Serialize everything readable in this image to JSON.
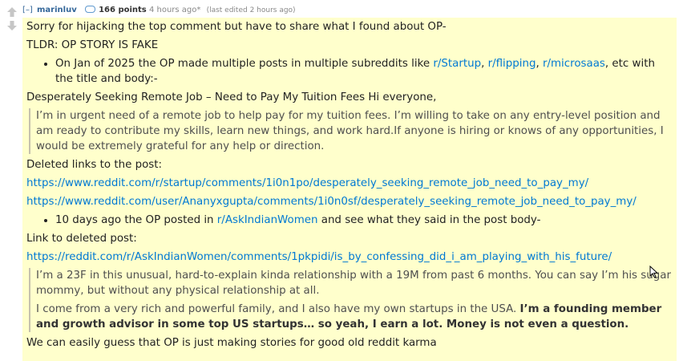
{
  "tagline": {
    "collapse": "[–]",
    "author": "marinluv",
    "score": "166 points",
    "time": "4 hours ago*",
    "edited": "(last edited 2 hours ago)"
  },
  "comment": {
    "p1": "Sorry for hijacking the top comment but have to share what I found about OP-",
    "p2": "TLDR: OP STORY IS FAKE",
    "li1_a": "On Jan of 2025 the OP made multiple posts in multiple subreddits like ",
    "li1_link1": "r/Startup",
    "li1_sep1": ", ",
    "li1_link2": "r/flipping",
    "li1_sep2": ", ",
    "li1_link3": "r/microsaas",
    "li1_b": ", etc with the title and body:-",
    "p3": "Desperately Seeking Remote Job – Need to Pay My Tuition Fees Hi everyone,",
    "quote1": "I’m in urgent need of a remote job to help pay for my tuition fees. I’m willing to take on any entry-level position and am ready to contribute my skills, learn new things, and work hard.If anyone is hiring or knows of any opportunities, I would be extremely grateful for any help or direction.",
    "p4": "Deleted links to the post:",
    "link1": "https://www.reddit.com/r/startup/comments/1i0n1po/desperately_seeking_remote_job_need_to_pay_my/",
    "link2": "https://www.reddit.com/user/Ananyxgupta/comments/1i0n0sf/desperately_seeking_remote_job_need_to_pay_my/",
    "li2_a": "10 days ago the OP posted in ",
    "li2_link": "r/AskIndianWomen",
    "li2_b": " and see what they said in the post body-",
    "p5": "Link to deleted post:",
    "link3": "https://reddit.com/r/AskIndianWomen/comments/1pkpidi/is_by_confessing_did_i_am_playing_with_his_future/",
    "quote2_p1": "I’m a 23F in this unusual, hard-to-explain kinda relationship with a 19M from past 6 months. You can say I’m his sugar mommy, but without any physical relationship at all.",
    "quote2_p2_a": "I come from a very rich and powerful family, and I also have my own startups in the USA. ",
    "quote2_p2_bold": "I’m a founding member and growth advisor in some top US startups… so yeah, I earn a lot. Money is not even a question.",
    "p6": "We can easily guess that OP is just making stories for good old reddit karma"
  },
  "icons": {
    "upvote": "arrow-up-icon",
    "downvote": "arrow-down-icon",
    "flair": "comment-bubble-icon",
    "cursor": "mouse-pointer-icon"
  },
  "colors": {
    "comment_bg": "#ffffcc",
    "link": "#0079d3",
    "author": "#336699",
    "quote_bar": "#c5c1ad"
  }
}
